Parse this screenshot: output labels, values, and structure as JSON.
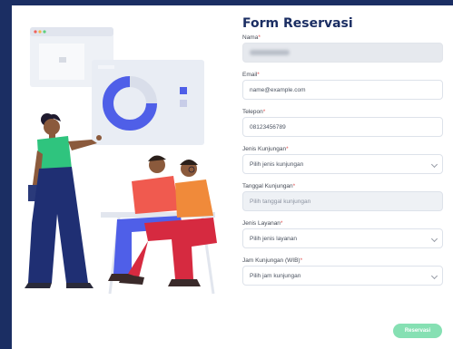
{
  "form": {
    "title": "Form Reservasi",
    "required_mark": "*",
    "fields": [
      {
        "label": "Nama",
        "value": ""
      },
      {
        "label": "Email",
        "value": "name@example.com"
      },
      {
        "label": "Telepon",
        "value": "08123456789"
      },
      {
        "label": "Jenis Kunjungan",
        "value": "Pilih jenis kunjungan"
      },
      {
        "label": "Tanggal Kunjungan",
        "placeholder": "Pilih tanggal kunjungan"
      },
      {
        "label": "Jenis Layanan",
        "value": "Pilih jenis layanan"
      },
      {
        "label": "Jam Kunjungan (WIB)",
        "value": "Pilih jam kunjungan"
      }
    ],
    "submit_label": "Reservasi"
  },
  "colors": {
    "frame": "#1b2e63",
    "title": "#1b2e63",
    "accent_ring": "#4f5fe8",
    "submit": "#86e0b3",
    "shirt_woman": "#2fc47e",
    "shirt_man": "#f05a4f",
    "shirt_woman2": "#f08a3a"
  },
  "illustration": {
    "icons": [
      "browser-window-icon",
      "donut-chart-icon",
      "presenter-woman",
      "seated-man",
      "seated-woman"
    ]
  }
}
